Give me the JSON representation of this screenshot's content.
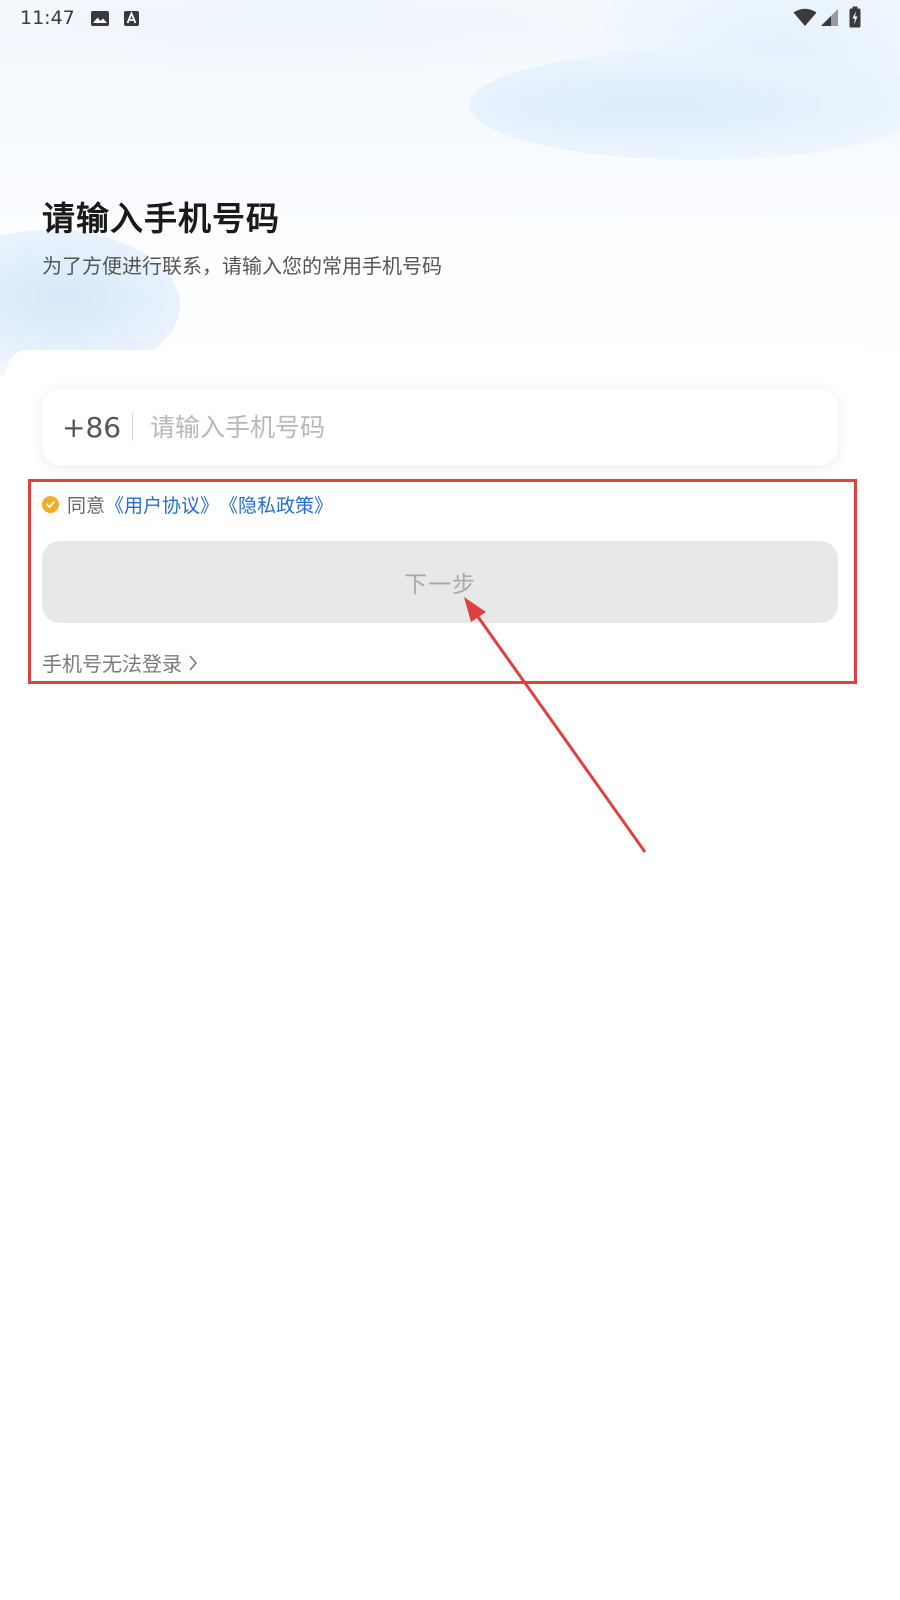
{
  "status_bar": {
    "time": "11:47",
    "icons": [
      "image-icon",
      "text-a-icon",
      "wifi-icon",
      "signal-icon",
      "battery-charging-icon"
    ]
  },
  "header": {
    "title": "请输入手机号码",
    "subtitle": "为了方便进行联系，请输入您的常用手机号码"
  },
  "phone_form": {
    "country_code": "+86",
    "phone_placeholder": "请输入手机号码",
    "phone_value": ""
  },
  "agreement": {
    "checked": true,
    "prefix": "同意",
    "user_agreement": "《用户协议》",
    "privacy_policy": "《隐私政策》"
  },
  "actions": {
    "next_label": "下一步",
    "cannot_login_label": "手机号无法登录"
  },
  "colors": {
    "accent_link": "#1f6fd6",
    "check": "#f2ad24",
    "annotation": "#e0403f",
    "button_disabled_bg": "#e8e8e8"
  }
}
